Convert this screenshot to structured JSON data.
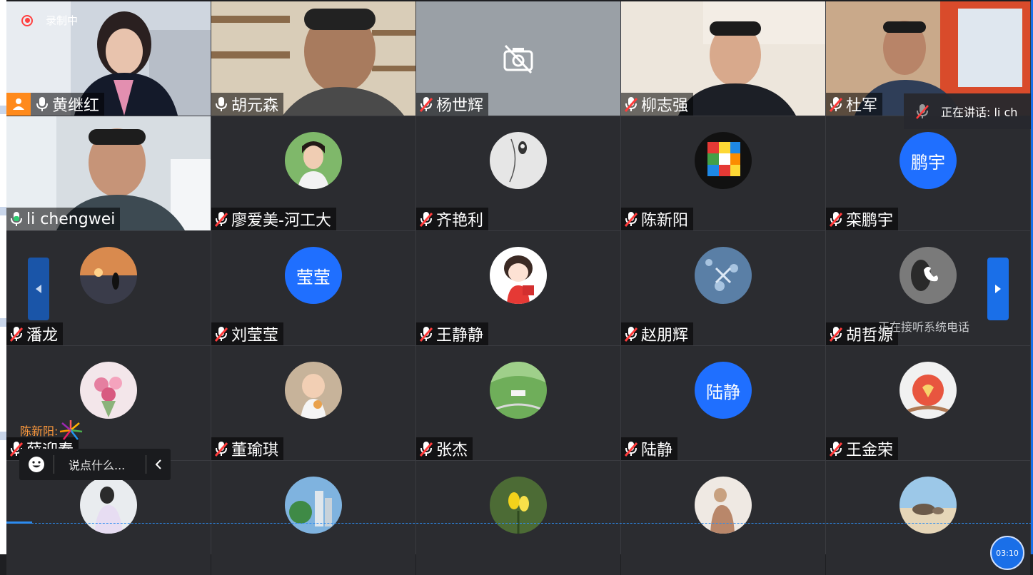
{
  "recording": {
    "label": "录制中"
  },
  "speaking": {
    "label": "正在讲话: li ch"
  },
  "phone_note": "正在接听系统电话",
  "chat": {
    "bubble_sender": "陈新阳:",
    "placeholder": "说点什么..."
  },
  "timer": "03:10",
  "colors": {
    "accent": "#1f6fff",
    "host_badge": "#ff8a1c",
    "recording": "#ff4040",
    "active_outline": "#2ecc71",
    "tile_bg": "#2b2c30"
  },
  "participants": [
    {
      "name": "黄继红",
      "mic": "on",
      "kind": "video",
      "host": true
    },
    {
      "name": "胡元森",
      "mic": "on",
      "kind": "video"
    },
    {
      "name": "杨世辉",
      "mic": "muted",
      "kind": "camera-off"
    },
    {
      "name": "柳志强",
      "mic": "muted",
      "kind": "video"
    },
    {
      "name": "杜军",
      "mic": "muted",
      "kind": "video"
    },
    {
      "name": "li chengwei",
      "mic": "speaking",
      "kind": "video",
      "active": true
    },
    {
      "name": "廖爱美-河工大",
      "mic": "muted",
      "kind": "photo"
    },
    {
      "name": "齐艳利",
      "mic": "muted",
      "kind": "photo"
    },
    {
      "name": "陈新阳",
      "mic": "muted",
      "kind": "photo"
    },
    {
      "name": "栾鹏宇",
      "mic": "muted",
      "kind": "text",
      "avatar_text": "鹏宇"
    },
    {
      "name": "潘龙",
      "mic": "muted",
      "kind": "photo"
    },
    {
      "name": "刘莹莹",
      "mic": "muted",
      "kind": "text",
      "avatar_text": "莹莹"
    },
    {
      "name": "王静静",
      "mic": "muted",
      "kind": "photo"
    },
    {
      "name": "赵朋辉",
      "mic": "muted",
      "kind": "photo"
    },
    {
      "name": "胡哲源",
      "mic": "muted",
      "kind": "photo"
    },
    {
      "name": "薛迎春",
      "mic": "muted",
      "kind": "photo"
    },
    {
      "name": "董瑜琪",
      "mic": "muted",
      "kind": "photo"
    },
    {
      "name": "张杰",
      "mic": "muted",
      "kind": "photo"
    },
    {
      "name": "陆静",
      "mic": "muted",
      "kind": "text",
      "avatar_text": "陆静"
    },
    {
      "name": "王金荣",
      "mic": "muted",
      "kind": "photo"
    },
    {
      "name": "",
      "mic": "muted",
      "kind": "photo"
    },
    {
      "name": "",
      "mic": "muted",
      "kind": "photo"
    },
    {
      "name": "",
      "mic": "muted",
      "kind": "photo"
    },
    {
      "name": "",
      "mic": "muted",
      "kind": "photo"
    },
    {
      "name": "",
      "mic": "muted",
      "kind": "photo"
    }
  ]
}
